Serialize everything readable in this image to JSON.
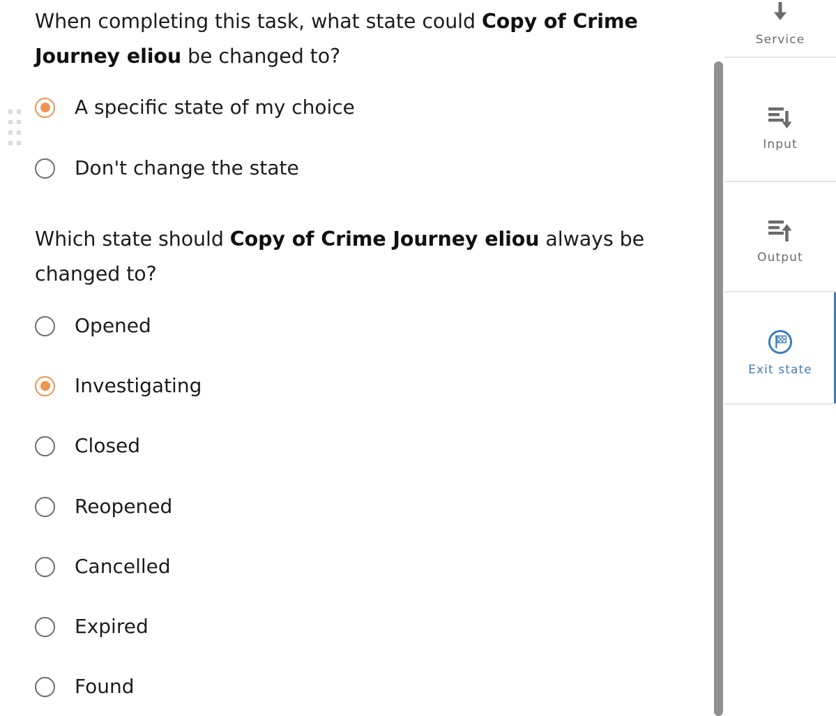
{
  "form": {
    "drag_handle_name": "drag-handle",
    "questions": [
      {
        "id": "q1",
        "text_before": "When completing this task, what state could ",
        "text_bold": "Copy of Crime Journey eliou",
        "text_after": " be changed to?",
        "full_text": "When completing this task, what state could Copy of Crime Journey eliou be changed to?",
        "options": [
          {
            "label": "A specific state of my choice",
            "selected": true
          },
          {
            "label": "Don't change the state",
            "selected": false
          }
        ]
      },
      {
        "id": "q2",
        "text_before": "Which state should ",
        "text_bold": "Copy of Crime Journey eliou",
        "text_after": " always be changed to?",
        "full_text": "Which state should Copy of Crime Journey eliou always be changed to?",
        "options": [
          {
            "label": "Opened",
            "selected": false
          },
          {
            "label": "Investigating",
            "selected": true
          },
          {
            "label": "Closed",
            "selected": false
          },
          {
            "label": "Reopened",
            "selected": false
          },
          {
            "label": "Cancelled",
            "selected": false
          },
          {
            "label": "Expired",
            "selected": false
          },
          {
            "label": "Found",
            "selected": false
          }
        ]
      }
    ]
  },
  "right_panel": {
    "items": [
      {
        "label": "Service",
        "icon": "arrow-down-icon",
        "active": false
      },
      {
        "label": "Input",
        "icon": "lines-arrow-down-icon",
        "active": false
      },
      {
        "label": "Output",
        "icon": "lines-arrow-up-icon",
        "active": false
      },
      {
        "label": "Exit state",
        "icon": "checkered-flag-icon",
        "active": true
      }
    ]
  },
  "scrollbar": {
    "name": "vertical-scrollbar",
    "thumb_name": "vertical-scrollbar-thumb"
  },
  "colors": {
    "accent_orange": "#ec9450",
    "accent_blue": "#3d7ebd",
    "radio_gray": "#6d6d6d",
    "text": "#1c1c1c",
    "muted_text": "#6b6b6b",
    "divider": "#e6e6e6",
    "scrollbar": "#919191",
    "drag_dot": "#dcdcdc"
  }
}
